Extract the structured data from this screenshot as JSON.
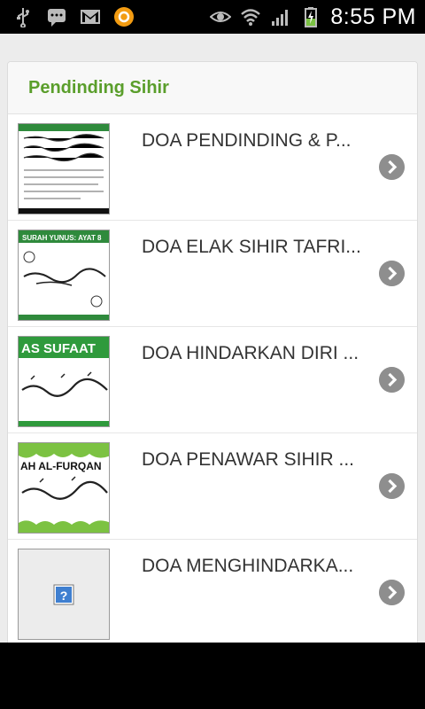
{
  "status_bar": {
    "time": "8:55 PM",
    "left_icons": [
      "usb-icon",
      "chat-icon",
      "gmail-icon",
      "app-notification-icon"
    ],
    "right_icons": [
      "eye-icon",
      "wifi-icon",
      "signal-icon",
      "battery-charging-icon"
    ]
  },
  "list": {
    "title": "Pendinding Sihir",
    "items": [
      {
        "title": "DOA PENDINDING & P...",
        "thumb_caption": ""
      },
      {
        "title": "DOA ELAK SIHIR TAFRI...",
        "thumb_caption": "SURAH YUNUS: AYAT 8"
      },
      {
        "title": "DOA HINDARKAN DIRI ...",
        "thumb_caption": "AS SUFAAT"
      },
      {
        "title": "DOA PENAWAR SIHIR ...",
        "thumb_caption": "AH AL-FURQAN"
      },
      {
        "title": "DOA MENGHINDARKA...",
        "thumb_caption": ""
      }
    ]
  },
  "colors": {
    "accent": "#5a9e2b",
    "chevron": "#8e8e8e",
    "background": "#ececec"
  }
}
